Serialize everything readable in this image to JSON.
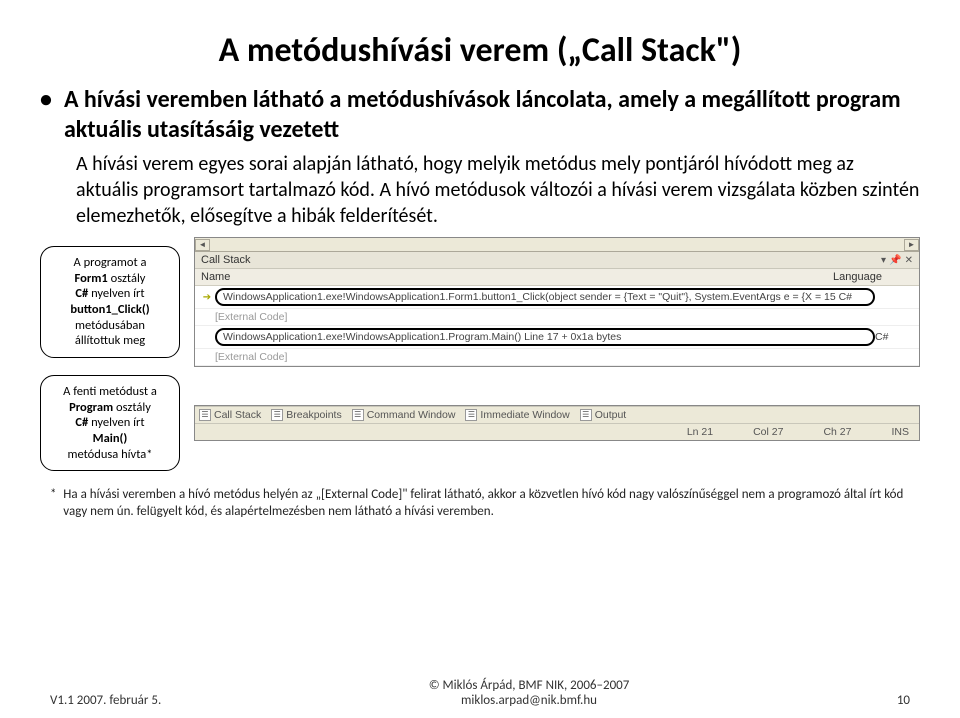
{
  "title": "A metódushívási verem („Call Stack\")",
  "bullet": "A hívási veremben látható a metódushívások láncolata, amely a megállított program aktuális utasításáig vezetett",
  "subtext": "A hívási verem egyes sorai alapján látható, hogy melyik metódus mely pontjáról hívódott meg az aktuális programsort tartalmazó kód. A hívó metódusok változói a hívási verem vizsgálata közben szintén elemezhetők, elősegítve a hibák felderítését.",
  "callout1": {
    "l1": "A programot a",
    "l2": "Form1",
    "l3": " osztály ",
    "l4": "C#",
    "l5": " nyelven írt ",
    "l6": "button1_Click()",
    "l7": " metódusában állítottuk meg"
  },
  "callout2": {
    "l1": "A fenti metódust a ",
    "l2": "Program",
    "l3": " osztály ",
    "l4": "C#",
    "l5": " nyelven írt ",
    "l6": "Main()",
    "l7": " metódusa hívta"
  },
  "callstack": {
    "panel_title": "Call Stack",
    "col_name": "Name",
    "col_lang": "Language",
    "rows": [
      {
        "icon": "➔",
        "name": "WindowsApplication1.exe!WindowsApplication1.Form1.button1_Click(object sender = {Text = \"Quit\"}, System.EventArgs e = {X = 15  C#",
        "lang": "",
        "hl": true
      },
      {
        "icon": "",
        "name": "[External Code]",
        "lang": "",
        "gray": true
      },
      {
        "icon": "",
        "name": "WindowsApplication1.exe!WindowsApplication1.Program.Main() Line 17 + 0x1a bytes",
        "lang": "C#",
        "hl": true
      },
      {
        "icon": "",
        "name": "[External Code]",
        "lang": "",
        "gray": true
      }
    ]
  },
  "tabs": [
    "Call Stack",
    "Breakpoints",
    "Command Window",
    "Immediate Window",
    "Output"
  ],
  "status": {
    "ln": "Ln 21",
    "col": "Col 27",
    "ch": "Ch 27",
    "ins": "INS"
  },
  "footnote_star": "*",
  "footnote": "Ha a hívási veremben a hívó metódus helyén az „[External Code]\" felirat látható, akkor a közvetlen hívó kód nagy valószínűséggel nem a programozó által írt kód vagy nem ún. felügyelt kód, és alapértelmezésben nem látható a hívási veremben.",
  "footer": {
    "left": "V1.1     2007. február 5.",
    "c1": "© Miklós Árpád, BMF NIK, 2006–2007",
    "c2": "miklos.arpad@nik.bmf.hu",
    "right": "10"
  }
}
